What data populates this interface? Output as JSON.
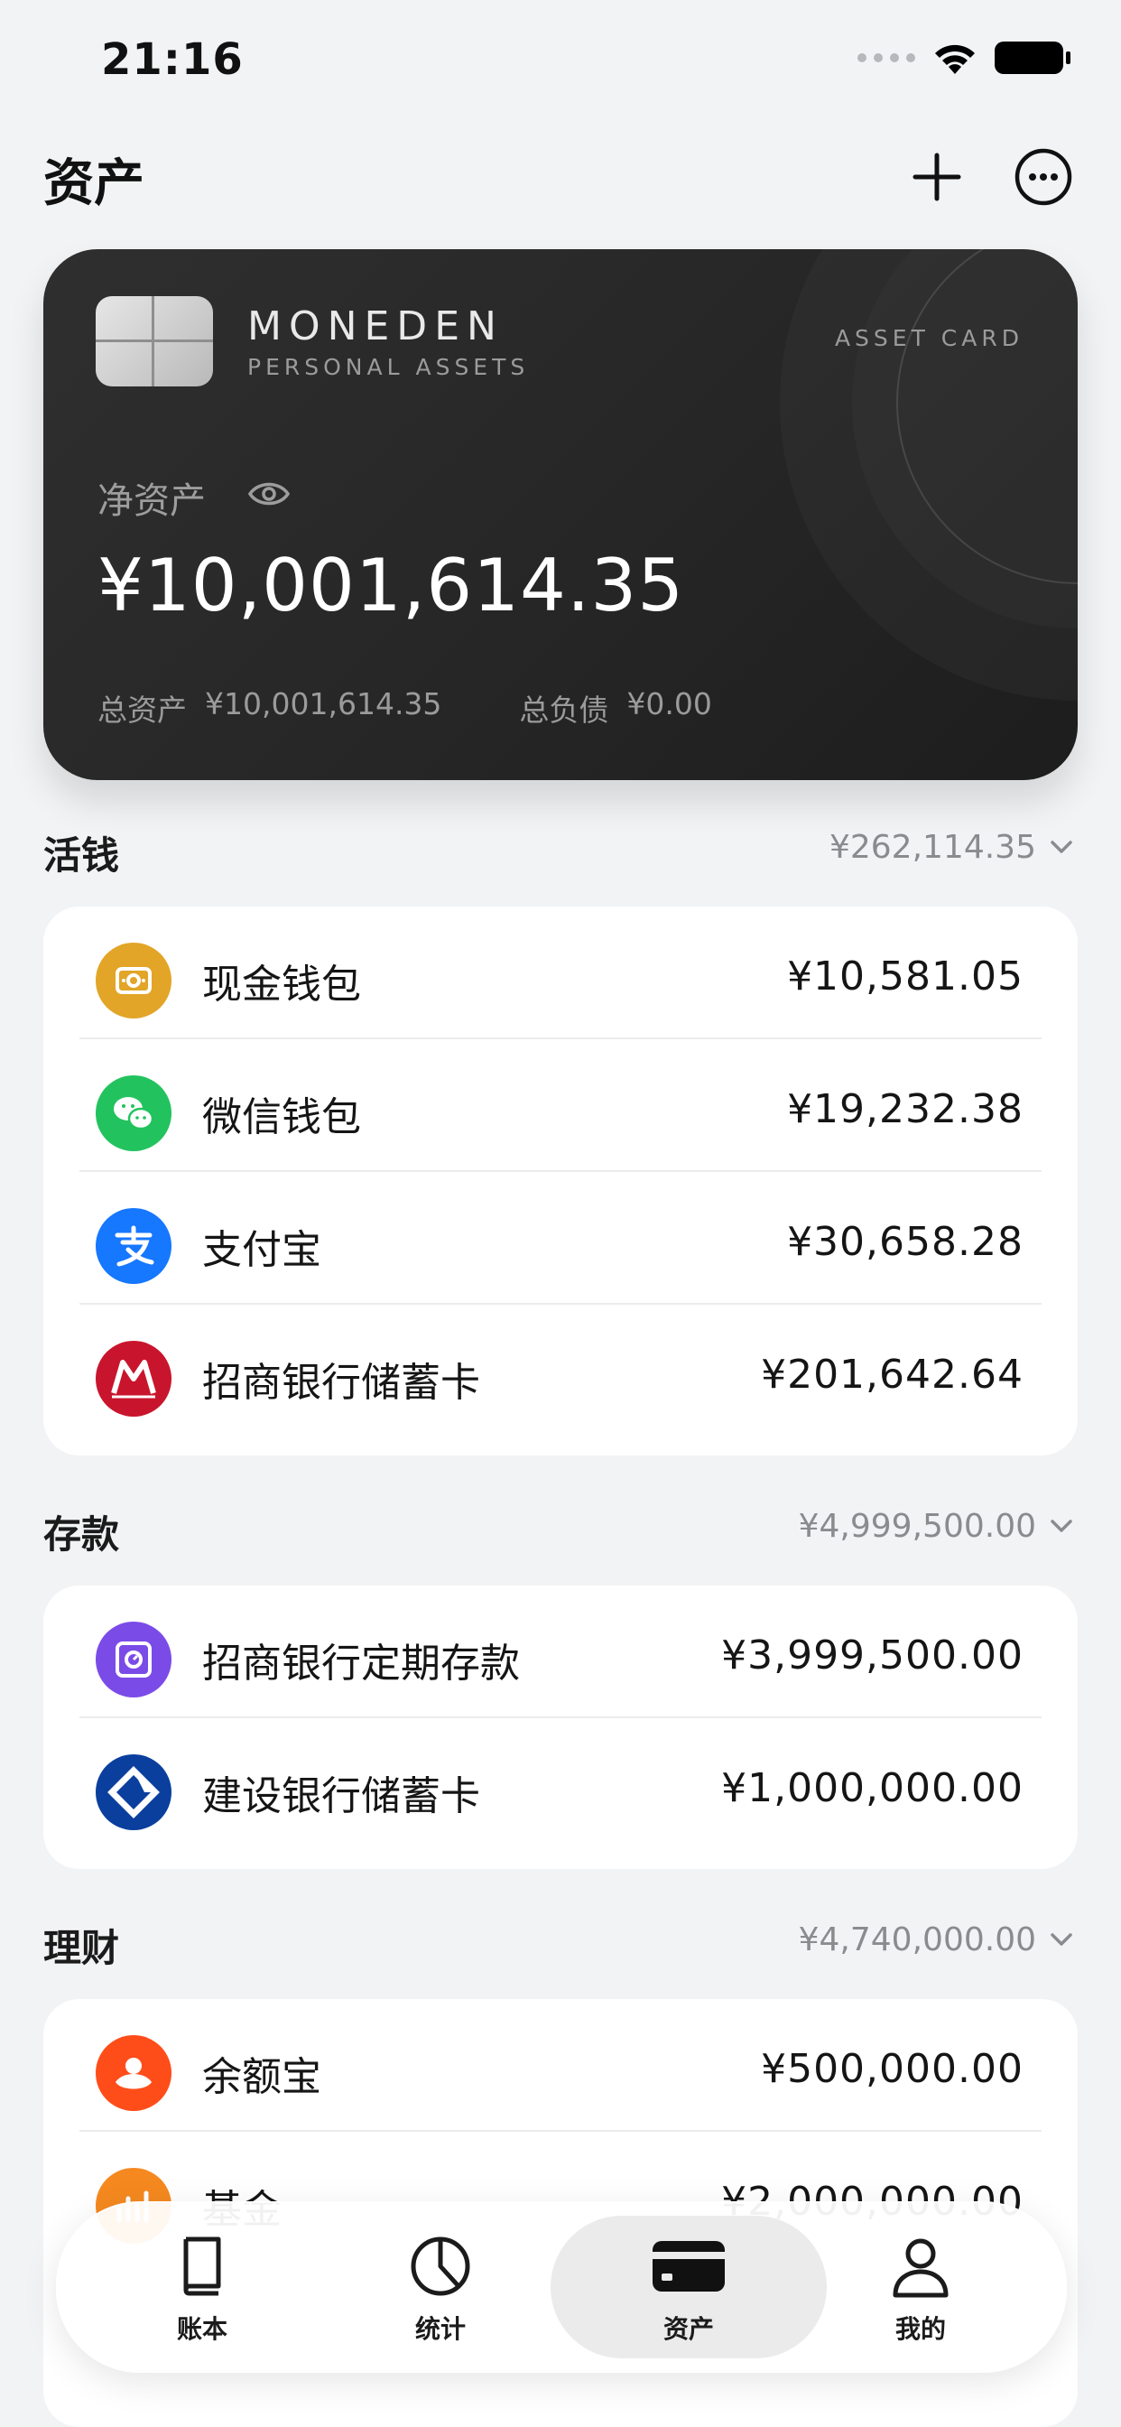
{
  "status_bar": {
    "time": "21:16"
  },
  "header": {
    "title": "资产"
  },
  "card": {
    "brand": "MONEDEN",
    "brand_sub": "PERSONAL ASSETS",
    "type": "ASSET CARD",
    "net_label": "净资产",
    "net_value": "¥10,001,614.35",
    "total_assets_label": "总资产",
    "total_assets_value": "¥10,001,614.35",
    "total_liab_label": "总负债",
    "total_liab_value": "¥0.00"
  },
  "sections": [
    {
      "title": "活钱",
      "total": "¥262,114.35",
      "items": [
        {
          "name": "现金钱包",
          "amount": "¥10,581.05",
          "icon": "cash-wallet-icon",
          "color": "#E2A527"
        },
        {
          "name": "微信钱包",
          "amount": "¥19,232.38",
          "icon": "wechat-icon",
          "color": "#22C35E"
        },
        {
          "name": "支付宝",
          "amount": "¥30,658.28",
          "icon": "alipay-icon",
          "color": "#1677FF"
        },
        {
          "name": "招商银行储蓄卡",
          "amount": "¥201,642.64",
          "icon": "cmb-icon",
          "color": "#C8152D"
        }
      ]
    },
    {
      "title": "存款",
      "total": "¥4,999,500.00",
      "items": [
        {
          "name": "招商银行定期存款",
          "amount": "¥3,999,500.00",
          "icon": "safe-deposit-icon",
          "color": "#7B4BE8"
        },
        {
          "name": "建设银行储蓄卡",
          "amount": "¥1,000,000.00",
          "icon": "ccb-icon",
          "color": "#0A3F9E"
        }
      ]
    },
    {
      "title": "理财",
      "total": "¥4,740,000.00",
      "items": [
        {
          "name": "余额宝",
          "amount": "¥500,000.00",
          "icon": "yuebao-icon",
          "color": "#FF4D1A"
        },
        {
          "name": "基金",
          "amount": "¥2,000,000.00",
          "icon": "fund-icon",
          "color": "#F5891F"
        }
      ]
    }
  ],
  "tabs": [
    {
      "label": "账本",
      "icon": "book-icon"
    },
    {
      "label": "统计",
      "icon": "pie-chart-icon"
    },
    {
      "label": "资产",
      "icon": "card-icon",
      "active": true
    },
    {
      "label": "我的",
      "icon": "person-icon"
    }
  ]
}
